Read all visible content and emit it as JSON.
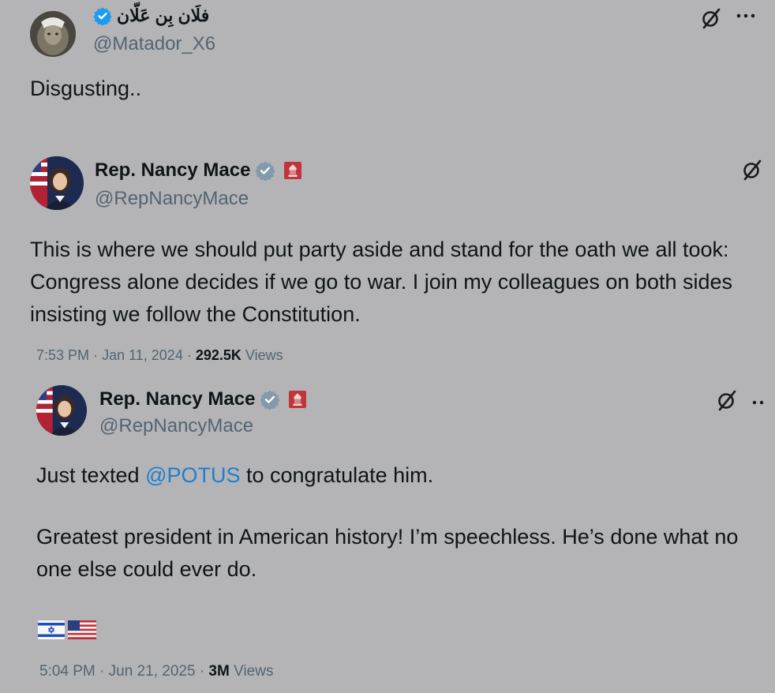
{
  "outer_tweet": {
    "display_name": "فلَان بِن عَلّان",
    "handle": "@Matador_X6",
    "text": "Disgusting.."
  },
  "quoted_tweet_1": {
    "display_name": "Rep. Nancy Mace",
    "handle": "@RepNancyMace",
    "text": "This is where we should put party aside and stand for the oath we all took: Congress alone decides if we go to war. I join my colleagues on both sides insisting we follow the Constitution.",
    "time": "7:53 PM",
    "date": "Jan 11, 2024",
    "views_count": "292.5K",
    "views_label": "Views"
  },
  "quoted_tweet_2": {
    "display_name": "Rep. Nancy Mace",
    "handle": "@RepNancyMace",
    "text_before_mention": "Just texted ",
    "mention": "@POTUS",
    "text_after_mention": " to congratulate him.",
    "text_paragraph_2": "Greatest president in American history! I’m speechless. He’s done what no one else could ever do.",
    "time": "5:04 PM",
    "date": "Jun 21, 2025",
    "views_count": "3M",
    "views_label": "Views"
  },
  "separator": "·",
  "icons": {
    "verified": "verified-badge-icon",
    "grok": "grok-icon",
    "more": "more-options-icon",
    "us_house": "us-house-badge-icon",
    "flag_israel": "israel-flag-icon",
    "flag_usa": "usa-flag-icon"
  },
  "colors": {
    "background": "#b4b4b6",
    "verified_blue": "#1d9bf0",
    "verified_gray": "#829aab",
    "mention_blue": "#1d7fd0",
    "house_badge_red": "#c0343b",
    "text_primary": "#0f1419",
    "text_secondary": "#536471"
  }
}
